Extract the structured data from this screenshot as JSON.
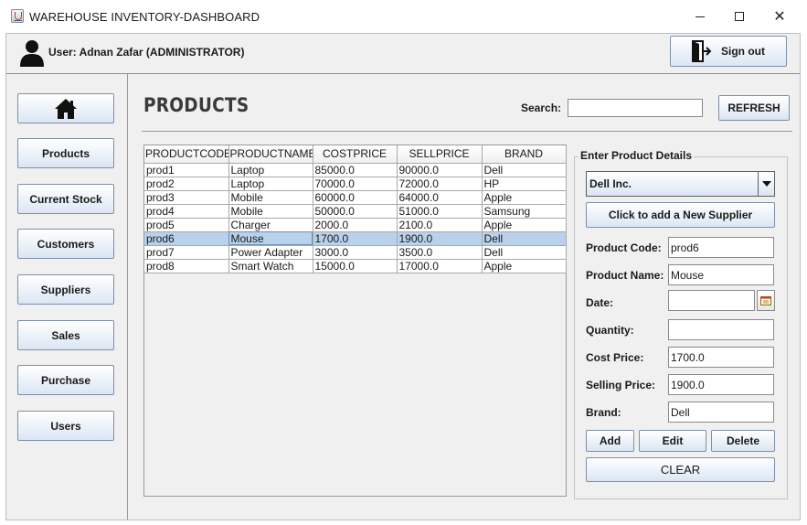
{
  "window": {
    "title": "WAREHOUSE INVENTORY-DASHBOARD",
    "controls": [
      "minimize",
      "maximize",
      "close"
    ]
  },
  "header": {
    "user_label": "User: Adnan Zafar (ADMINISTRATOR)",
    "sign_out_label": "Sign out"
  },
  "sidebar": {
    "home_icon": "home-icon",
    "items": [
      {
        "label": "Products"
      },
      {
        "label": "Current Stock"
      },
      {
        "label": "Customers"
      },
      {
        "label": "Suppliers"
      },
      {
        "label": "Sales"
      },
      {
        "label": "Purchase"
      },
      {
        "label": "Users"
      }
    ]
  },
  "main": {
    "page_title": "PRODUCTS",
    "search_label": "Search:",
    "search_value": "",
    "refresh_label": "REFRESH"
  },
  "table": {
    "columns": [
      "PRODUCTCODE",
      "PRODUCTNAME",
      "COSTPRICE",
      "SELLPRICE",
      "BRAND"
    ],
    "rows": [
      [
        "prod1",
        "Laptop",
        "85000.0",
        "90000.0",
        "Dell"
      ],
      [
        "prod2",
        "Laptop",
        "70000.0",
        "72000.0",
        "HP"
      ],
      [
        "prod3",
        "Mobile",
        "60000.0",
        "64000.0",
        "Apple"
      ],
      [
        "prod4",
        "Mobile",
        "50000.0",
        "51000.0",
        "Samsung"
      ],
      [
        "prod5",
        "Charger",
        "2000.0",
        "2100.0",
        "Apple"
      ],
      [
        "prod6",
        "Mouse",
        "1700.0",
        "1900.0",
        "Dell"
      ],
      [
        "prod7",
        "Power Adapter",
        "3000.0",
        "3500.0",
        "Dell"
      ],
      [
        "prod8",
        "Smart Watch",
        "15000.0",
        "17000.0",
        "Apple"
      ]
    ],
    "selected_row": 5
  },
  "details": {
    "legend": "Enter Product Details",
    "supplier_selected": "Dell Inc.",
    "add_supplier_label": "Click to add a New Supplier",
    "fields": {
      "product_code": {
        "label": "Product Code:",
        "value": "prod6"
      },
      "product_name": {
        "label": "Product Name:",
        "value": "Mouse"
      },
      "date": {
        "label": "Date:",
        "value": ""
      },
      "quantity": {
        "label": "Quantity:",
        "value": ""
      },
      "cost_price": {
        "label": "Cost Price:",
        "value": "1700.0"
      },
      "selling_price": {
        "label": "Selling Price:",
        "value": "1900.0"
      },
      "brand": {
        "label": "Brand:",
        "value": "Dell"
      }
    },
    "add_label": "Add",
    "edit_label": "Edit",
    "delete_label": "Delete",
    "clear_label": "CLEAR"
  },
  "colors": {
    "button_gradient_top": "#ffffff",
    "button_gradient_bottom": "#dbe6f4",
    "selected_row": "#b9d1ea",
    "panel_background": "#f0f0f0"
  }
}
